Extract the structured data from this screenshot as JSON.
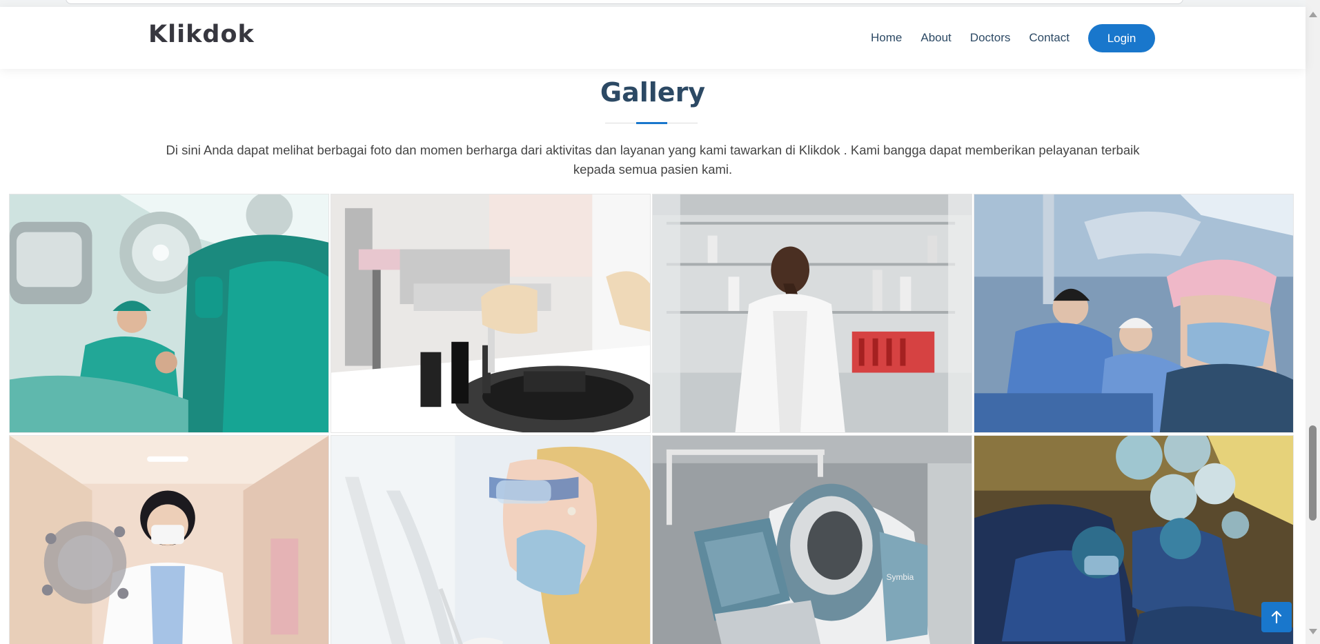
{
  "header": {
    "logo": "Klikdok",
    "nav": [
      "Home",
      "About",
      "Doctors",
      "Contact"
    ],
    "login_label": "Login"
  },
  "gallery": {
    "title": "Gallery",
    "description": "Di sini Anda dapat melihat berbagai foto dan momen berharga dari aktivitas dan layanan yang kami tawarkan di Klikdok . Kami bangga dapat memberikan pelayanan terbaik kepada semua pasien kami.",
    "images": [
      "surgeons-operating-room-photo",
      "lab-centrifuge-test-tube-photo",
      "scientist-in-laboratory-photo",
      "surgical-team-blue-gowns-photo",
      "doctor-with-virus-illustration-photo",
      "researcher-with-goggles-photo",
      "mri-scanner-machine-photo",
      "surgeon-under-operating-lights-photo"
    ]
  },
  "colors": {
    "accent": "#1977cc",
    "heading": "#2c4964",
    "text": "#444444"
  },
  "icons": {
    "back_to_top": "arrow-up-icon"
  }
}
